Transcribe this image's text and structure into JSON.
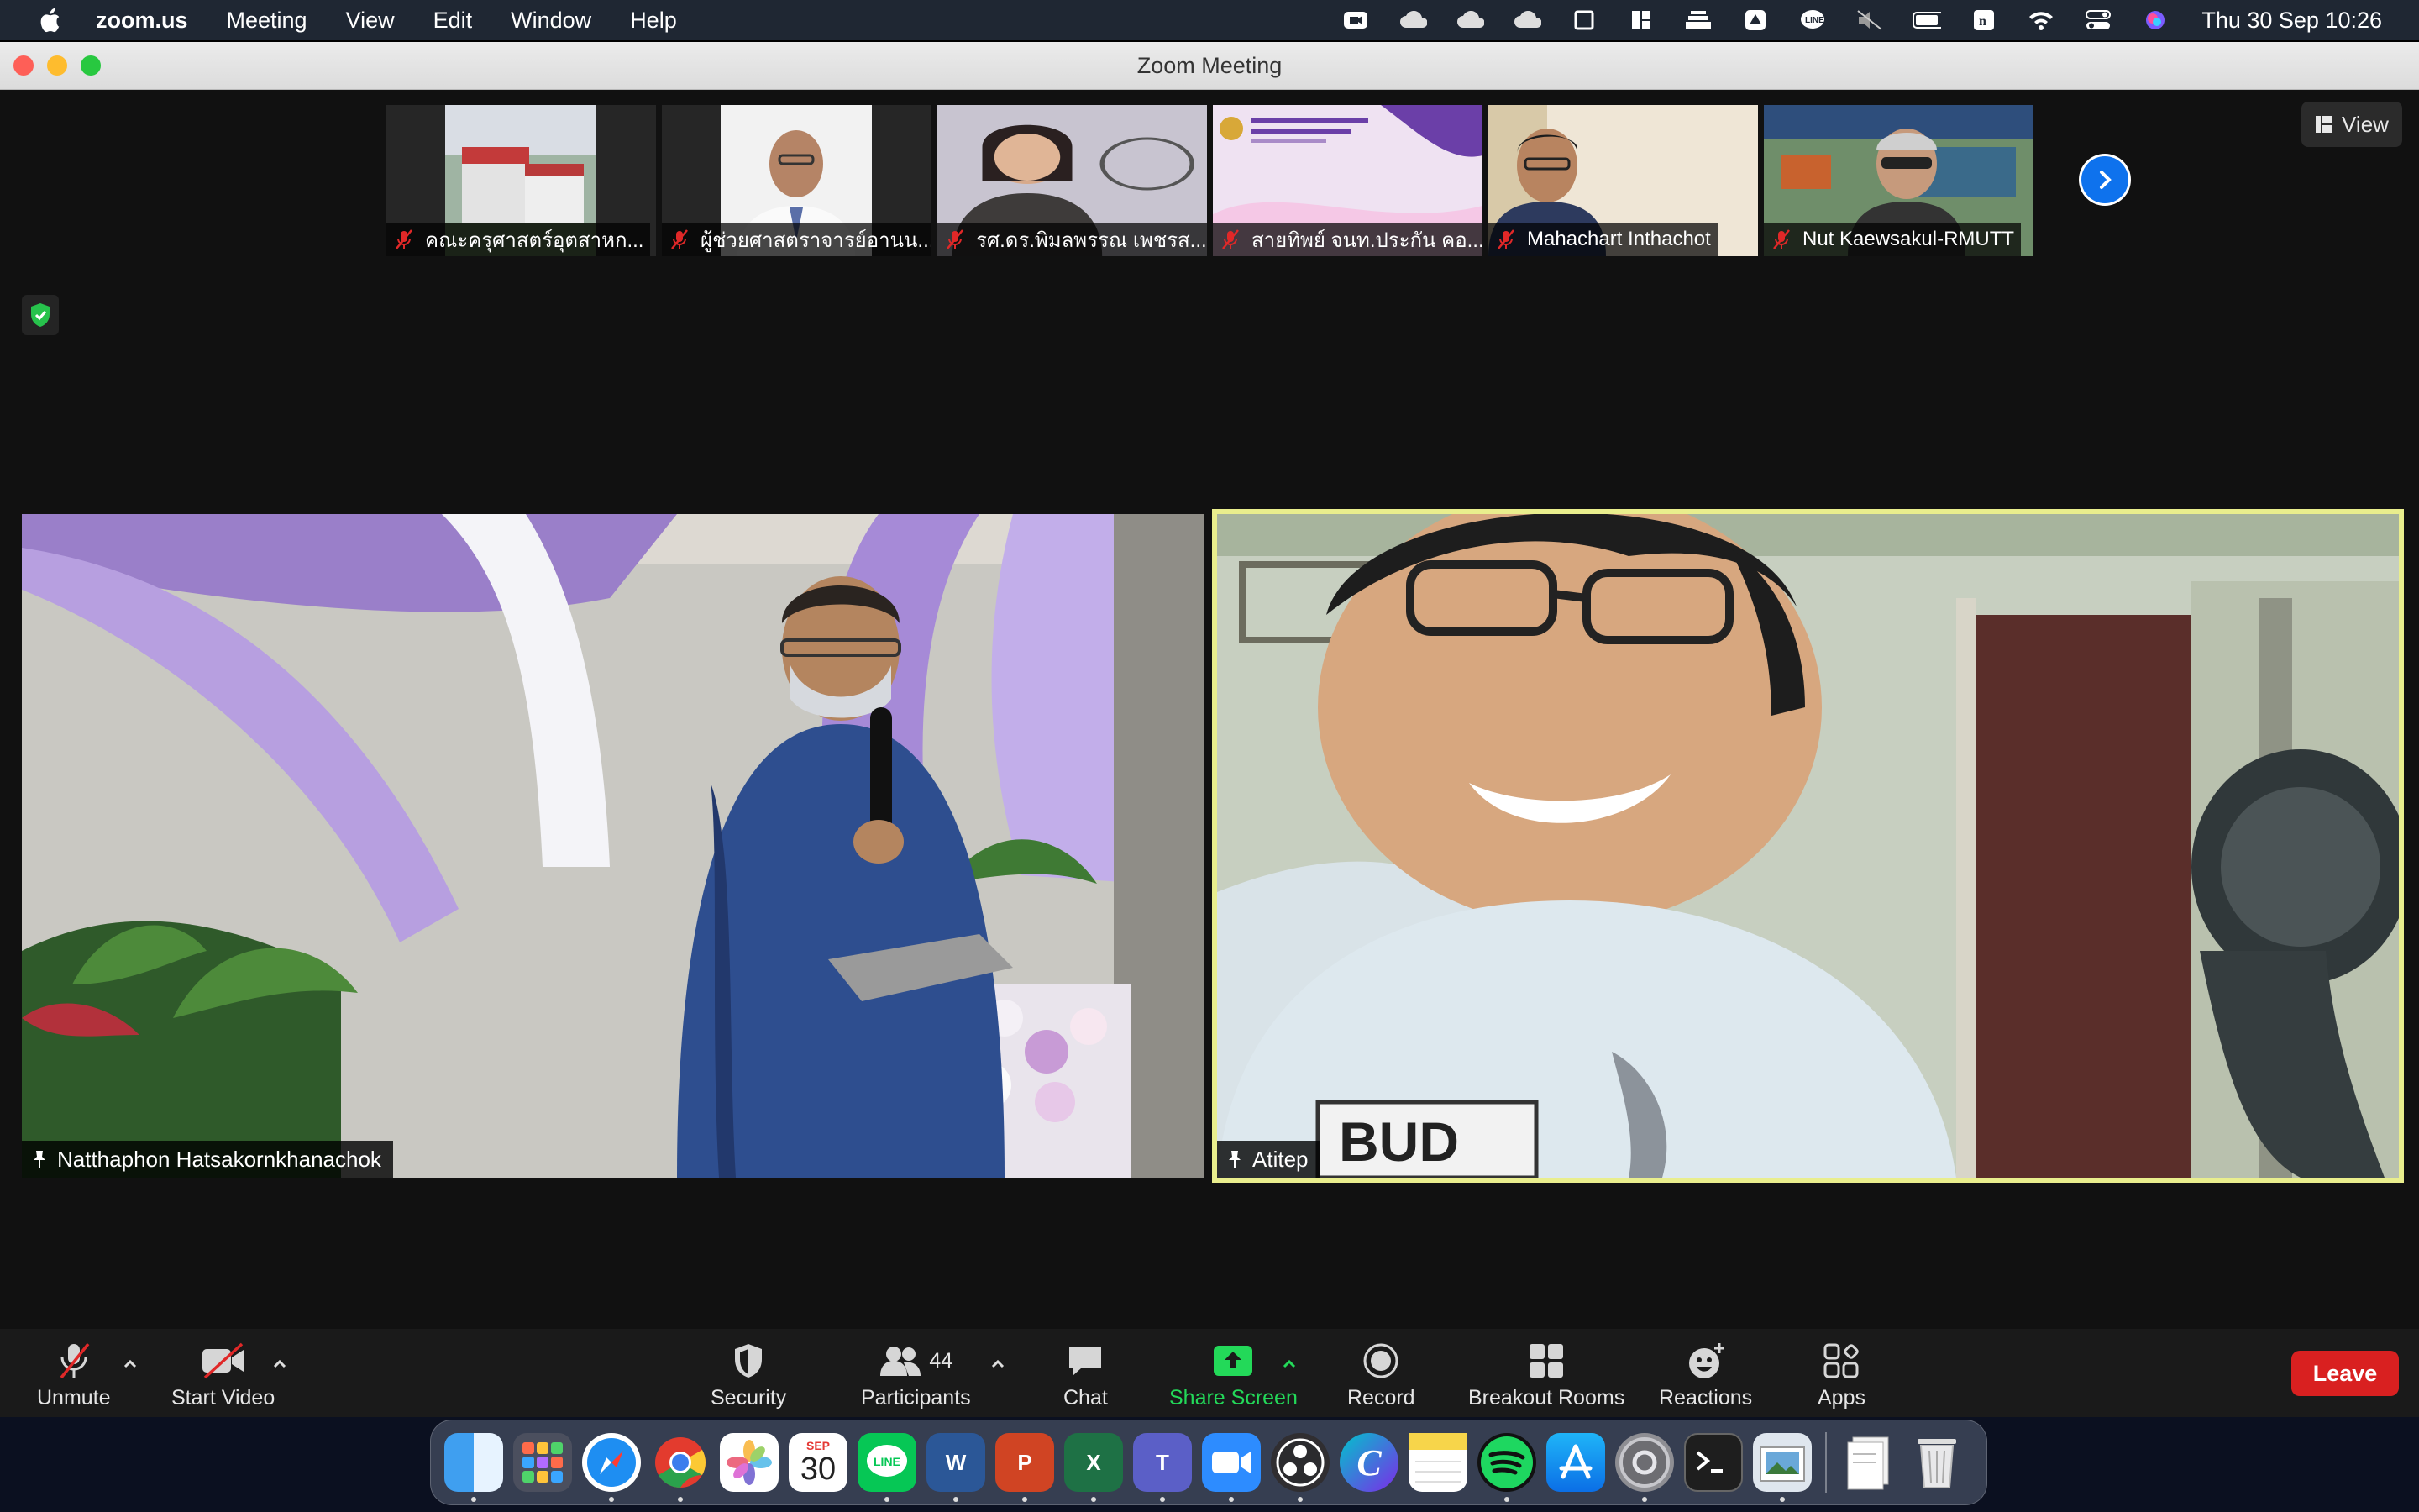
{
  "menubar": {
    "app_name": "zoom.us",
    "menus": [
      "Meeting",
      "View",
      "Edit",
      "Window",
      "Help"
    ],
    "clock": "Thu 30 Sep  10:26"
  },
  "window": {
    "title": "Zoom Meeting"
  },
  "gallery": {
    "thumbnails": [
      {
        "name": "คณะครุศาสตร์อุตสาหก...",
        "muted": true
      },
      {
        "name": "ผู้ช่วยศาสตราจารย์อานน...",
        "muted": true
      },
      {
        "name": "รศ.ดร.พิมลพรรณ เพชรส...",
        "muted": true
      },
      {
        "name": "สายทิพย์ จนท.ประกัน คอ...",
        "muted": true
      },
      {
        "name": "Mahachart Inthachot",
        "muted": true
      },
      {
        "name": "Nut Kaewsakul-RMUTT",
        "muted": true
      }
    ],
    "view_label": "View"
  },
  "main_tiles": {
    "left": {
      "name": "Natthaphon Hatsakornkhanachok"
    },
    "right": {
      "name": "Atitep",
      "active_speaker": true
    }
  },
  "toolbar": {
    "unmute": "Unmute",
    "start_video": "Start Video",
    "security": "Security",
    "participants": "Participants",
    "participants_count": "44",
    "chat": "Chat",
    "share_screen": "Share Screen",
    "record": "Record",
    "breakout_rooms": "Breakout Rooms",
    "reactions": "Reactions",
    "apps": "Apps",
    "leave": "Leave"
  },
  "dock": {
    "calendar_month": "SEP",
    "calendar_day": "30",
    "apps": [
      "Finder",
      "Launchpad",
      "Safari",
      "Chrome",
      "Photos",
      "Calendar",
      "LINE",
      "Word",
      "PowerPoint",
      "Excel",
      "Teams",
      "Zoom",
      "OBS",
      "Canva",
      "Notes",
      "Spotify",
      "App Store",
      "System Preferences",
      "Terminal",
      "Preview",
      "Documents",
      "Trash"
    ]
  },
  "colors": {
    "accent_blue": "#0e72ed",
    "share_green": "#23d959",
    "leave_red": "#d92020",
    "active_speaker_border": "#e9ee8d"
  }
}
